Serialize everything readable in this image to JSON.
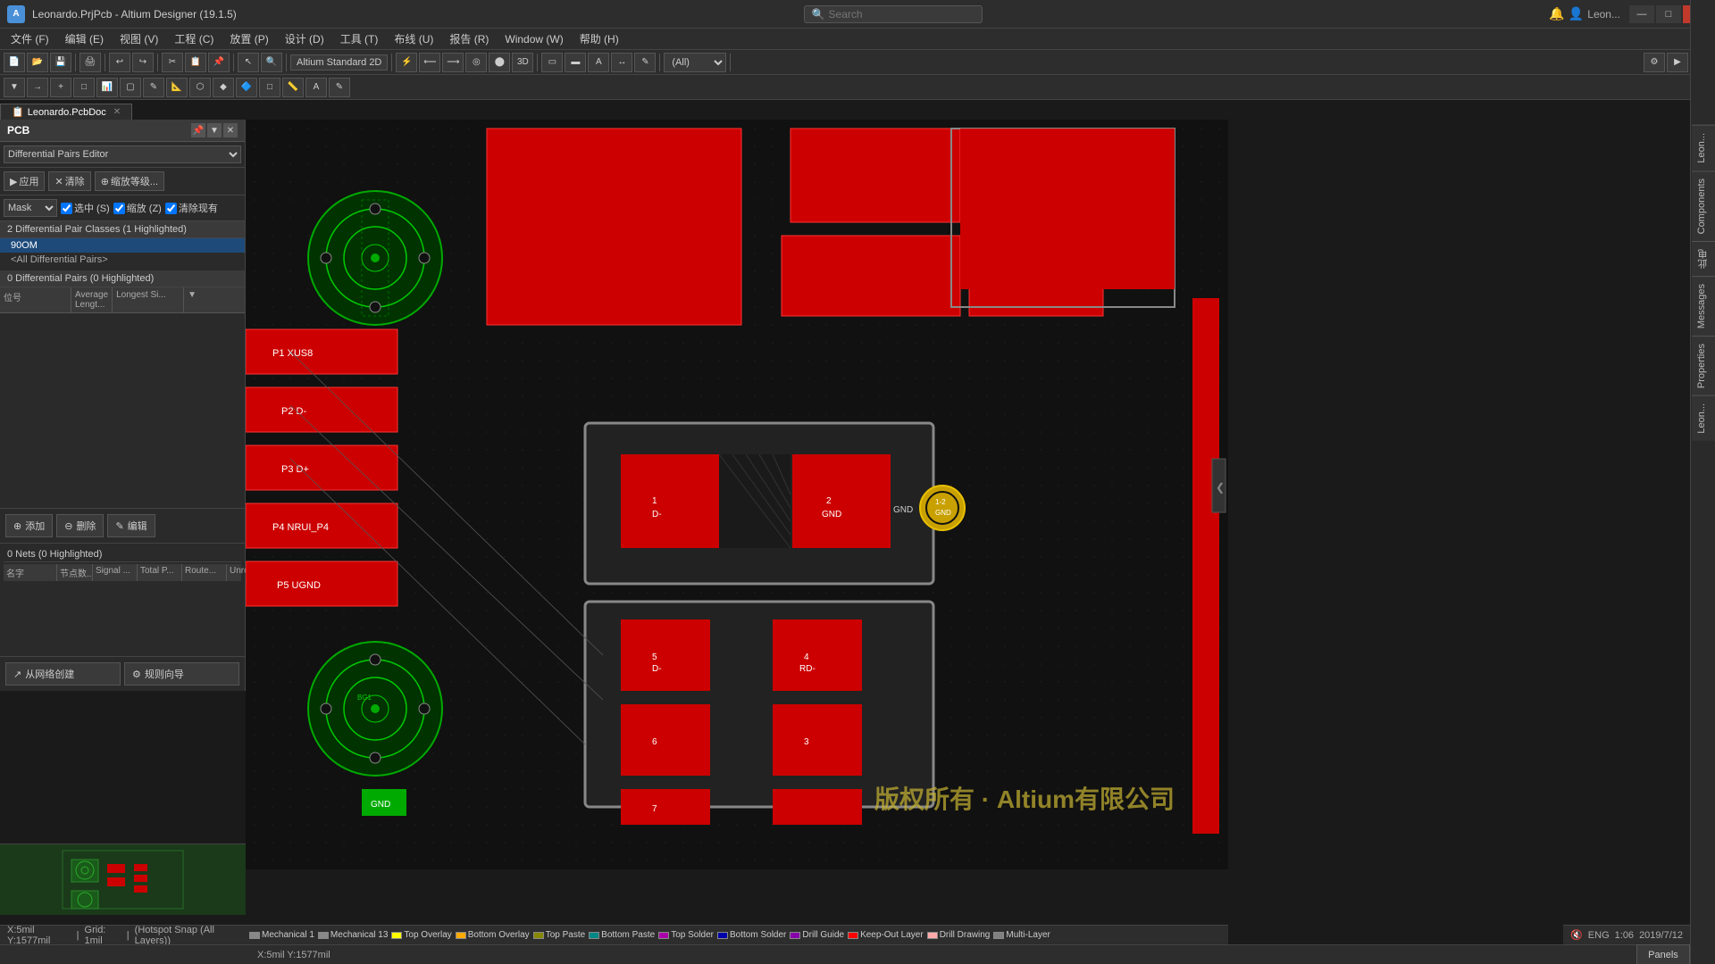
{
  "titlebar": {
    "title": "Leonardo.PrjPcb - Altium Designer (19.1.5)",
    "search_placeholder": "Search",
    "btn_minimize": "—",
    "btn_maximize": "□",
    "btn_close": "✕"
  },
  "menubar": {
    "items": [
      "文件 (F)",
      "编辑 (E)",
      "视图 (V)",
      "工程 (C)",
      "放置 (P)",
      "设计 (D)",
      "工具 (T)",
      "布线 (U)",
      "报告 (R)",
      "Window (W)",
      "帮助 (H)"
    ]
  },
  "toolbar1": {
    "mode_label": "Altium Standard 2D",
    "all_label": "(All)"
  },
  "doc_tab": {
    "label": "Leonardo.PcbDoc"
  },
  "left_panel": {
    "header": "PCB",
    "dropdown_value": "Differential Pairs Editor",
    "filter_btn": "应用",
    "clear_btn": "清除",
    "rank_btn": "缩放等级...",
    "mask_label": "Mask",
    "select_label": "选中 (S)",
    "zoom_label": "缩放 (Z)",
    "clear_label": "清除现有",
    "classes_header": "2 Differential Pair Classes (1 Highlighted)",
    "class_items": [
      "90OM",
      "<All Differential Pairs>"
    ],
    "pairs_section_header": "0 Differential Pairs (0 Highlighted)",
    "pairs_cols": [
      "位号",
      "Average Lengt...",
      "Longest Si..."
    ],
    "nets_header": "0 Nets (0 Highlighted)",
    "nets_cols": [
      "名字",
      "节点数...",
      "Signal ...",
      "Total P...",
      "Route...",
      "Unrout..."
    ],
    "add_btn": "添加",
    "delete_btn": "删除",
    "edit_btn": "编辑",
    "from_net_btn": "从网络创建",
    "rule_guide_btn": "规则向导"
  },
  "status_bar": {
    "coords": "X:5mil Y:1577mil",
    "grid": "Grid: 1mil",
    "hotspot": "(Hotspot Snap (All Layers))",
    "panels_btn": "Panels"
  },
  "layers": [
    {
      "label": "Mechanical 1",
      "color": "#888888"
    },
    {
      "label": "Mechanical 13",
      "color": "#888888"
    },
    {
      "label": "Top Overlay",
      "color": "#ffff00"
    },
    {
      "label": "Bottom Overlay",
      "color": "#ffaa00"
    },
    {
      "label": "Top Paste",
      "color": "#888800"
    },
    {
      "label": "Bottom Paste",
      "color": "#008888"
    },
    {
      "label": "Top Solder",
      "color": "#aa00aa"
    },
    {
      "label": "Bottom Solder",
      "color": "#0000aa"
    },
    {
      "label": "Drill Guide",
      "color": "#8800aa"
    },
    {
      "label": "Keep-Out Layer",
      "color": "#ff0000"
    },
    {
      "label": "Drill Drawing",
      "color": "#ffaaaa"
    },
    {
      "label": "Multi-Layer",
      "color": "#808080"
    }
  ],
  "right_tabs": [
    "Leon...",
    "Components",
    "此电",
    "Messages",
    "Properties",
    "Leon..."
  ],
  "watermark": "版权所有 · Altium有限公司",
  "icons": {
    "filter": "▼",
    "clear": "✕",
    "zoom": "⊕",
    "add": "+",
    "delete": "—",
    "edit": "✎",
    "net_create": "↗",
    "rule": "⚙",
    "search": "🔍",
    "minimize": "—",
    "maximize": "□",
    "close": "✕",
    "chevron_right": "❯",
    "chevron_left": "❮"
  },
  "toolbar2_items": [
    "✕",
    "→",
    "+",
    "□",
    "📊",
    "□",
    "✎",
    "📐",
    "⬡",
    "◆",
    "🔷",
    "□",
    "📏",
    "A",
    "✎"
  ]
}
